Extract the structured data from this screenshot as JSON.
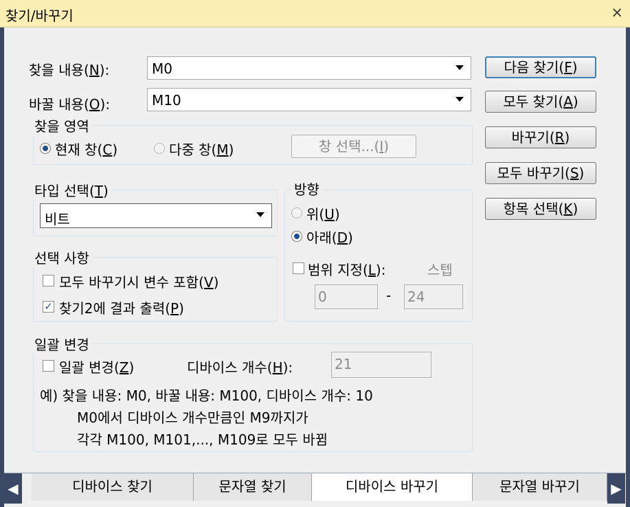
{
  "window": {
    "title": "찾기/바꾸기",
    "close_glyph": "×"
  },
  "find": {
    "label": "찾을 내용(",
    "key": "N",
    "label_end": "):",
    "value": "M0"
  },
  "replace": {
    "label": "바꿀 내용(",
    "key": "O",
    "label_end": "):",
    "value": "M10"
  },
  "buttons": {
    "find_next": {
      "label": "다음 찾기(",
      "key": "F",
      "end": ")"
    },
    "find_all": {
      "label": "모두 찾기(",
      "key": "A",
      "end": ")"
    },
    "replace": {
      "label": "바꾸기(",
      "key": "R",
      "end": ")"
    },
    "replace_all": {
      "label": "모두 바꾸기(",
      "key": "S",
      "end": ")"
    },
    "select_items": {
      "label": "항목 선택(",
      "key": "K",
      "end": ")"
    }
  },
  "search_area": {
    "title": "찾을 영역",
    "current": {
      "label": "현재 창(",
      "key": "C",
      "end": ")"
    },
    "multi": {
      "label": "다중 창(",
      "key": "M",
      "end": ")"
    },
    "select_window": {
      "label": "창 선택...(",
      "key": "I",
      "end": ")"
    }
  },
  "type_select": {
    "title_label": "타입 선택(",
    "key": "T",
    "end": ")",
    "value": "비트"
  },
  "direction": {
    "title": "방향",
    "up": {
      "label": "위(",
      "key": "U",
      "end": ")"
    },
    "down": {
      "label": "아래(",
      "key": "D",
      "end": ")"
    },
    "range": {
      "label": "범위 지정(",
      "key": "L",
      "end": "):"
    },
    "step_label": "스텝",
    "from": "0",
    "dash": "-",
    "to": "24"
  },
  "options": {
    "title": "선택 사항",
    "include_vars": {
      "label": "모두 바꾸기시 변수 포함(",
      "key": "V",
      "end": ")"
    },
    "output_find2": {
      "label": "찾기2에 결과 출력(",
      "key": "P",
      "end": ")"
    }
  },
  "batch": {
    "title": "일괄 변경",
    "check": {
      "label": "일괄 변경(",
      "key": "Z",
      "end": ")"
    },
    "count": {
      "label": "디바이스 개수(",
      "key": "H",
      "end": "):",
      "value": "21"
    },
    "example_1": "예) 찾을 내용: M0, 바꿀 내용: M100, 디바이스 개수: 10",
    "example_2": "M0에서 디바이스 개수만큼인 M9까지가",
    "example_3": "각각 M100, M101,..., M109로 모두 바뀜"
  },
  "tabs": [
    "디바이스 찾기",
    "문자열 찾기",
    "디바이스 바꾸기",
    "문자열 바꾸기"
  ],
  "tab_nav": {
    "prev": "◀",
    "next": "▶"
  }
}
